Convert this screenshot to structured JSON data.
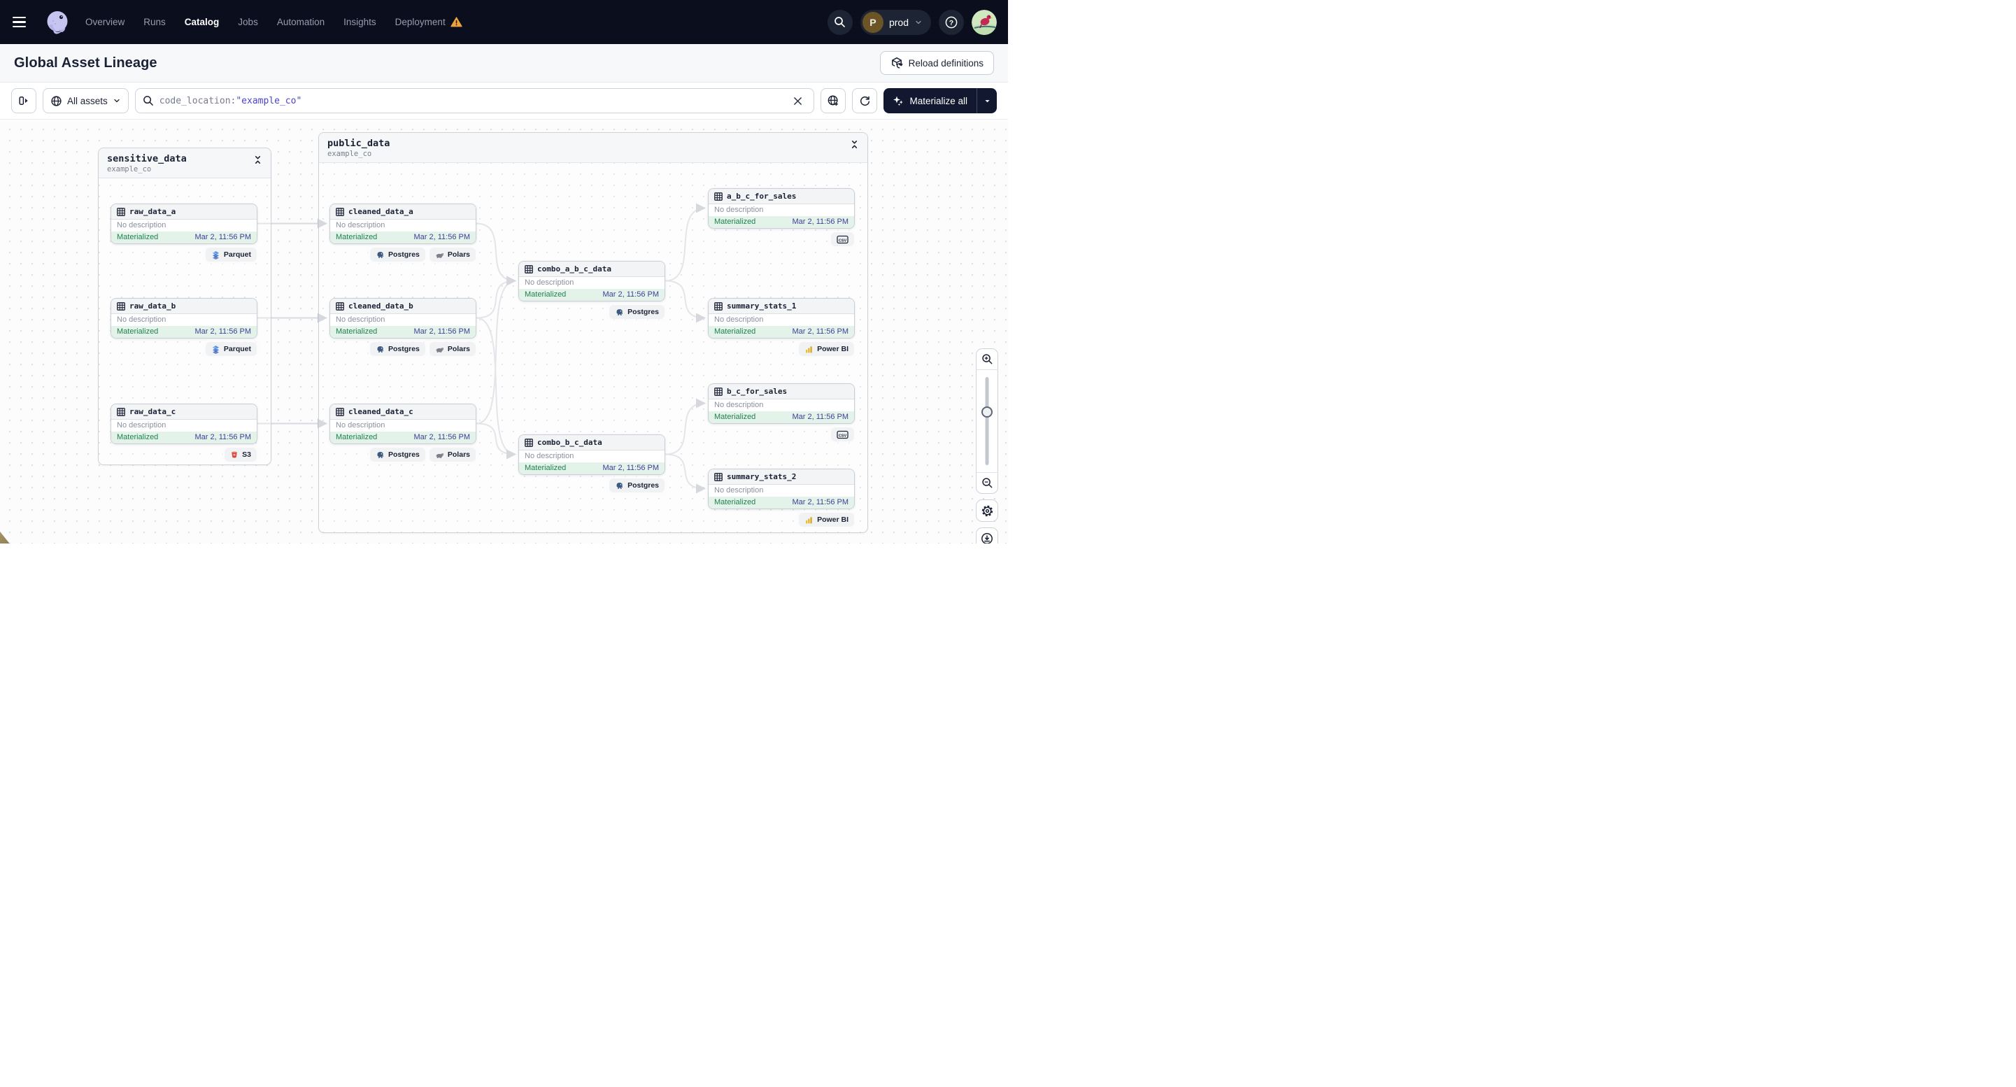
{
  "colors": {
    "nav_bg": "#0a0e1d",
    "accent_indigo": "#4a43ce",
    "status_green": "#1f8150",
    "status_green_bg": "#e4f3ea",
    "timestamp_blue": "#3f3d98",
    "warning_orange": "#eda23d",
    "dark_button_bg": "#121830"
  },
  "nav": {
    "items": [
      {
        "label": "Overview",
        "active": false,
        "warning": false
      },
      {
        "label": "Runs",
        "active": false,
        "warning": false
      },
      {
        "label": "Catalog",
        "active": true,
        "warning": false
      },
      {
        "label": "Jobs",
        "active": false,
        "warning": false
      },
      {
        "label": "Automation",
        "active": false,
        "warning": false
      },
      {
        "label": "Insights",
        "active": false,
        "warning": false
      },
      {
        "label": "Deployment",
        "active": false,
        "warning": true
      }
    ],
    "environment": {
      "initial": "P",
      "name": "prod"
    }
  },
  "header": {
    "title": "Global Asset Lineage",
    "reload_label": "Reload definitions"
  },
  "toolbar": {
    "scope_label": "All assets",
    "search_token_key": "code_location:",
    "search_token_value": "\"example_co\"",
    "materialize_label": "Materialize all"
  },
  "graph": {
    "groups": [
      {
        "id": "sensitive_data",
        "name": "sensitive_data",
        "location": "example_co"
      },
      {
        "id": "public_data",
        "name": "public_data",
        "location": "example_co"
      }
    ],
    "node_defaults": {
      "description": "No description",
      "status": "Materialized",
      "timestamp": "Mar 2, 11:56 PM"
    },
    "nodes": [
      {
        "id": "raw_data_a",
        "group": "sensitive_data",
        "tags": [
          {
            "label": "Parquet",
            "icon": "parquet-icon"
          }
        ]
      },
      {
        "id": "raw_data_b",
        "group": "sensitive_data",
        "tags": [
          {
            "label": "Parquet",
            "icon": "parquet-icon"
          }
        ]
      },
      {
        "id": "raw_data_c",
        "group": "sensitive_data",
        "tags": [
          {
            "label": "S3",
            "icon": "s3-icon"
          }
        ]
      },
      {
        "id": "cleaned_data_a",
        "group": "public_data",
        "tags": [
          {
            "label": "Postgres",
            "icon": "postgres-icon"
          },
          {
            "label": "Polars",
            "icon": "polars-icon"
          }
        ]
      },
      {
        "id": "cleaned_data_b",
        "group": "public_data",
        "tags": [
          {
            "label": "Postgres",
            "icon": "postgres-icon"
          },
          {
            "label": "Polars",
            "icon": "polars-icon"
          }
        ]
      },
      {
        "id": "cleaned_data_c",
        "group": "public_data",
        "tags": [
          {
            "label": "Postgres",
            "icon": "postgres-icon"
          },
          {
            "label": "Polars",
            "icon": "polars-icon"
          }
        ]
      },
      {
        "id": "combo_a_b_c_data",
        "group": "public_data",
        "tags": [
          {
            "label": "Postgres",
            "icon": "postgres-icon"
          }
        ]
      },
      {
        "id": "combo_b_c_data",
        "group": "public_data",
        "tags": [
          {
            "label": "Postgres",
            "icon": "postgres-icon"
          }
        ]
      },
      {
        "id": "a_b_c_for_sales",
        "group": "public_data",
        "tags": [
          {
            "label": "",
            "icon": "csv-icon"
          }
        ]
      },
      {
        "id": "summary_stats_1",
        "group": "public_data",
        "tags": [
          {
            "label": "Power BI",
            "icon": "powerbi-icon"
          }
        ]
      },
      {
        "id": "b_c_for_sales",
        "group": "public_data",
        "tags": [
          {
            "label": "",
            "icon": "csv-icon"
          }
        ]
      },
      {
        "id": "summary_stats_2",
        "group": "public_data",
        "tags": [
          {
            "label": "Power BI",
            "icon": "powerbi-icon"
          }
        ]
      }
    ],
    "edges": [
      {
        "from": "raw_data_a",
        "to": "cleaned_data_a"
      },
      {
        "from": "raw_data_b",
        "to": "cleaned_data_b"
      },
      {
        "from": "raw_data_c",
        "to": "cleaned_data_c"
      },
      {
        "from": "cleaned_data_a",
        "to": "combo_a_b_c_data"
      },
      {
        "from": "cleaned_data_b",
        "to": "combo_a_b_c_data"
      },
      {
        "from": "cleaned_data_c",
        "to": "combo_a_b_c_data"
      },
      {
        "from": "cleaned_data_b",
        "to": "combo_b_c_data"
      },
      {
        "from": "cleaned_data_c",
        "to": "combo_b_c_data"
      },
      {
        "from": "combo_a_b_c_data",
        "to": "a_b_c_for_sales"
      },
      {
        "from": "combo_a_b_c_data",
        "to": "summary_stats_1"
      },
      {
        "from": "combo_b_c_data",
        "to": "b_c_for_sales"
      },
      {
        "from": "combo_b_c_data",
        "to": "summary_stats_2"
      }
    ]
  }
}
